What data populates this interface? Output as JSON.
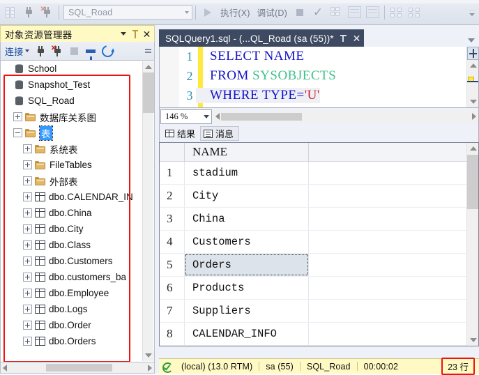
{
  "toolbar": {
    "db_combo_value": "SQL_Road",
    "execute_label": "执行(X)",
    "debug_label": "调试(D)",
    "icons": [
      "grid-dots-icon",
      "connect-plug-icon",
      "disconnect-plug-icon",
      "run-triangle-icon",
      "stop-square-icon",
      "check-parse-icon",
      "query-plan-icon",
      "results-to-text-icon",
      "results-to-file-icon",
      "include-actual-plan-icon",
      "client-statistics-icon",
      "toolbar-overflow-icon"
    ]
  },
  "object_explorer": {
    "title": "对象资源管理器",
    "title_icons": [
      "chevron-down-icon",
      "pin-icon",
      "close-icon"
    ],
    "toolbar": {
      "connect_label": "连接",
      "icons": [
        "connect-icon",
        "disconnect-icon",
        "stop-icon",
        "filter-icon",
        "refresh-icon",
        "grip-icon"
      ]
    },
    "tree": [
      {
        "label": "School",
        "icon": "database-icon",
        "indent": 0,
        "expander": "none",
        "selected": false
      },
      {
        "label": "Snapshot_Test",
        "icon": "database-icon",
        "indent": 0,
        "expander": "none",
        "selected": false
      },
      {
        "label": "SQL_Road",
        "icon": "database-icon",
        "indent": 0,
        "expander": "none",
        "selected": false
      },
      {
        "label": "数据库关系图",
        "icon": "folder-icon",
        "indent": 1,
        "expander": "plus",
        "selected": false
      },
      {
        "label": "表",
        "icon": "folder-icon",
        "indent": 1,
        "expander": "minus",
        "selected": true
      },
      {
        "label": "系统表",
        "icon": "folder-icon",
        "indent": 2,
        "expander": "plus",
        "selected": false
      },
      {
        "label": "FileTables",
        "icon": "folder-icon",
        "indent": 2,
        "expander": "plus",
        "selected": false
      },
      {
        "label": "外部表",
        "icon": "folder-icon",
        "indent": 2,
        "expander": "plus",
        "selected": false
      },
      {
        "label": "dbo.CALENDAR_IN",
        "icon": "table-icon",
        "indent": 2,
        "expander": "plus",
        "selected": false
      },
      {
        "label": "dbo.China",
        "icon": "table-icon",
        "indent": 2,
        "expander": "plus",
        "selected": false
      },
      {
        "label": "dbo.City",
        "icon": "table-icon",
        "indent": 2,
        "expander": "plus",
        "selected": false
      },
      {
        "label": "dbo.Class",
        "icon": "table-icon",
        "indent": 2,
        "expander": "plus",
        "selected": false
      },
      {
        "label": "dbo.Customers",
        "icon": "table-icon",
        "indent": 2,
        "expander": "plus",
        "selected": false
      },
      {
        "label": "dbo.customers_ba",
        "icon": "table-icon",
        "indent": 2,
        "expander": "plus",
        "selected": false
      },
      {
        "label": "dbo.Employee",
        "icon": "table-icon",
        "indent": 2,
        "expander": "plus",
        "selected": false
      },
      {
        "label": "dbo.Logs",
        "icon": "table-icon",
        "indent": 2,
        "expander": "plus",
        "selected": false
      },
      {
        "label": "dbo.Order",
        "icon": "table-icon",
        "indent": 2,
        "expander": "plus",
        "selected": false
      },
      {
        "label": "dbo.Orders",
        "icon": "table-icon",
        "indent": 2,
        "expander": "plus",
        "selected": false
      }
    ]
  },
  "editor": {
    "tab_title": "SQLQuery1.sql - (...QL_Road (sa (55))*",
    "tab_icons": [
      "pin-icon",
      "close-icon"
    ],
    "code_lines": [
      {
        "num": "1",
        "tokens": [
          {
            "t": "SELECT",
            "c": "kw"
          },
          {
            "t": " ",
            "c": "pln"
          },
          {
            "t": "NAME",
            "c": "kw"
          }
        ]
      },
      {
        "num": "2",
        "tokens": [
          {
            "t": "FROM",
            "c": "kw"
          },
          {
            "t": " ",
            "c": "pln"
          },
          {
            "t": "SYSOBJECTS",
            "c": "tbl"
          }
        ]
      },
      {
        "num": "3",
        "tokens": [
          {
            "t": "WHERE",
            "c": "kw"
          },
          {
            "t": " ",
            "c": "pln"
          },
          {
            "t": "TYPE=",
            "c": "kw"
          },
          {
            "t": "'U'",
            "c": "str"
          }
        ]
      }
    ],
    "zoom_level": "146 %"
  },
  "results": {
    "tabs": [
      {
        "label": "结果",
        "icon": "grid-icon",
        "active": true
      },
      {
        "label": "消息",
        "icon": "message-icon",
        "active": false
      }
    ],
    "columns": [
      "NAME"
    ],
    "rows": [
      {
        "n": "1",
        "NAME": "stadium",
        "selected": false
      },
      {
        "n": "2",
        "NAME": "City",
        "selected": false
      },
      {
        "n": "3",
        "NAME": "China",
        "selected": false
      },
      {
        "n": "4",
        "NAME": "Customers",
        "selected": false
      },
      {
        "n": "5",
        "NAME": "Orders",
        "selected": true
      },
      {
        "n": "6",
        "NAME": "Products",
        "selected": false
      },
      {
        "n": "7",
        "NAME": "Suppliers",
        "selected": false
      },
      {
        "n": "8",
        "NAME": "CALENDAR_INFO",
        "selected": false
      }
    ]
  },
  "statusbar": {
    "status_icon": "connected-check-icon",
    "server": "(local) (13.0 RTM)",
    "user": "sa (55)",
    "database": "SQL_Road",
    "elapsed": "00:00:02",
    "row_count": "23 行"
  },
  "colors": {
    "oe_title_bg": "#fff9c4",
    "statusbar_bg": "#fff9c4",
    "annotation_red": "#ee1111",
    "doc_tab_bg": "#3e4a61",
    "selection_blue": "#3399ff",
    "keyword_blue": "#1212c8",
    "table_green": "#3fbf8f",
    "string_red": "#cc2222",
    "line_number_teal": "#2b91af",
    "change_bar_yellow": "#ffe93d"
  }
}
